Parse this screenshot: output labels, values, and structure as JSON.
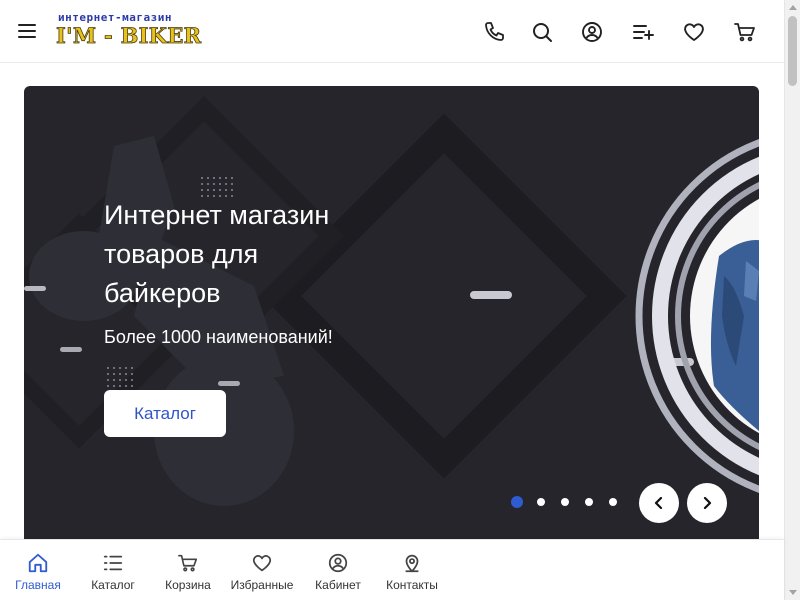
{
  "header": {
    "logo_top": "интернет-магазин",
    "logo_main": "I'M - BIKER",
    "icons": [
      "menu-icon",
      "phone-icon",
      "search-icon",
      "user-icon",
      "compare-list-icon",
      "heart-icon",
      "cart-icon"
    ]
  },
  "hero": {
    "title_line1": "Интернет магазин",
    "title_line2": "товаров для",
    "title_line3": "байкеров",
    "subtitle": "Более 1000 наименований!",
    "button_label": "Каталог",
    "slides_count": 5,
    "active_slide": 1
  },
  "bottom_nav": {
    "items": [
      {
        "label": "Главная",
        "icon": "home-icon"
      },
      {
        "label": "Каталог",
        "icon": "catalog-list-icon"
      },
      {
        "label": "Корзина",
        "icon": "cart-icon"
      },
      {
        "label": "Избранные",
        "icon": "heart-icon"
      },
      {
        "label": "Кабинет",
        "icon": "user-icon"
      },
      {
        "label": "Контакты",
        "icon": "location-pin-icon"
      }
    ],
    "active_index": 0
  },
  "colors": {
    "accent": "#2f5bd3",
    "hero_bg": "#25252b",
    "logo_gold": "#e8c21a",
    "logo_blue": "#2c3aa5"
  }
}
